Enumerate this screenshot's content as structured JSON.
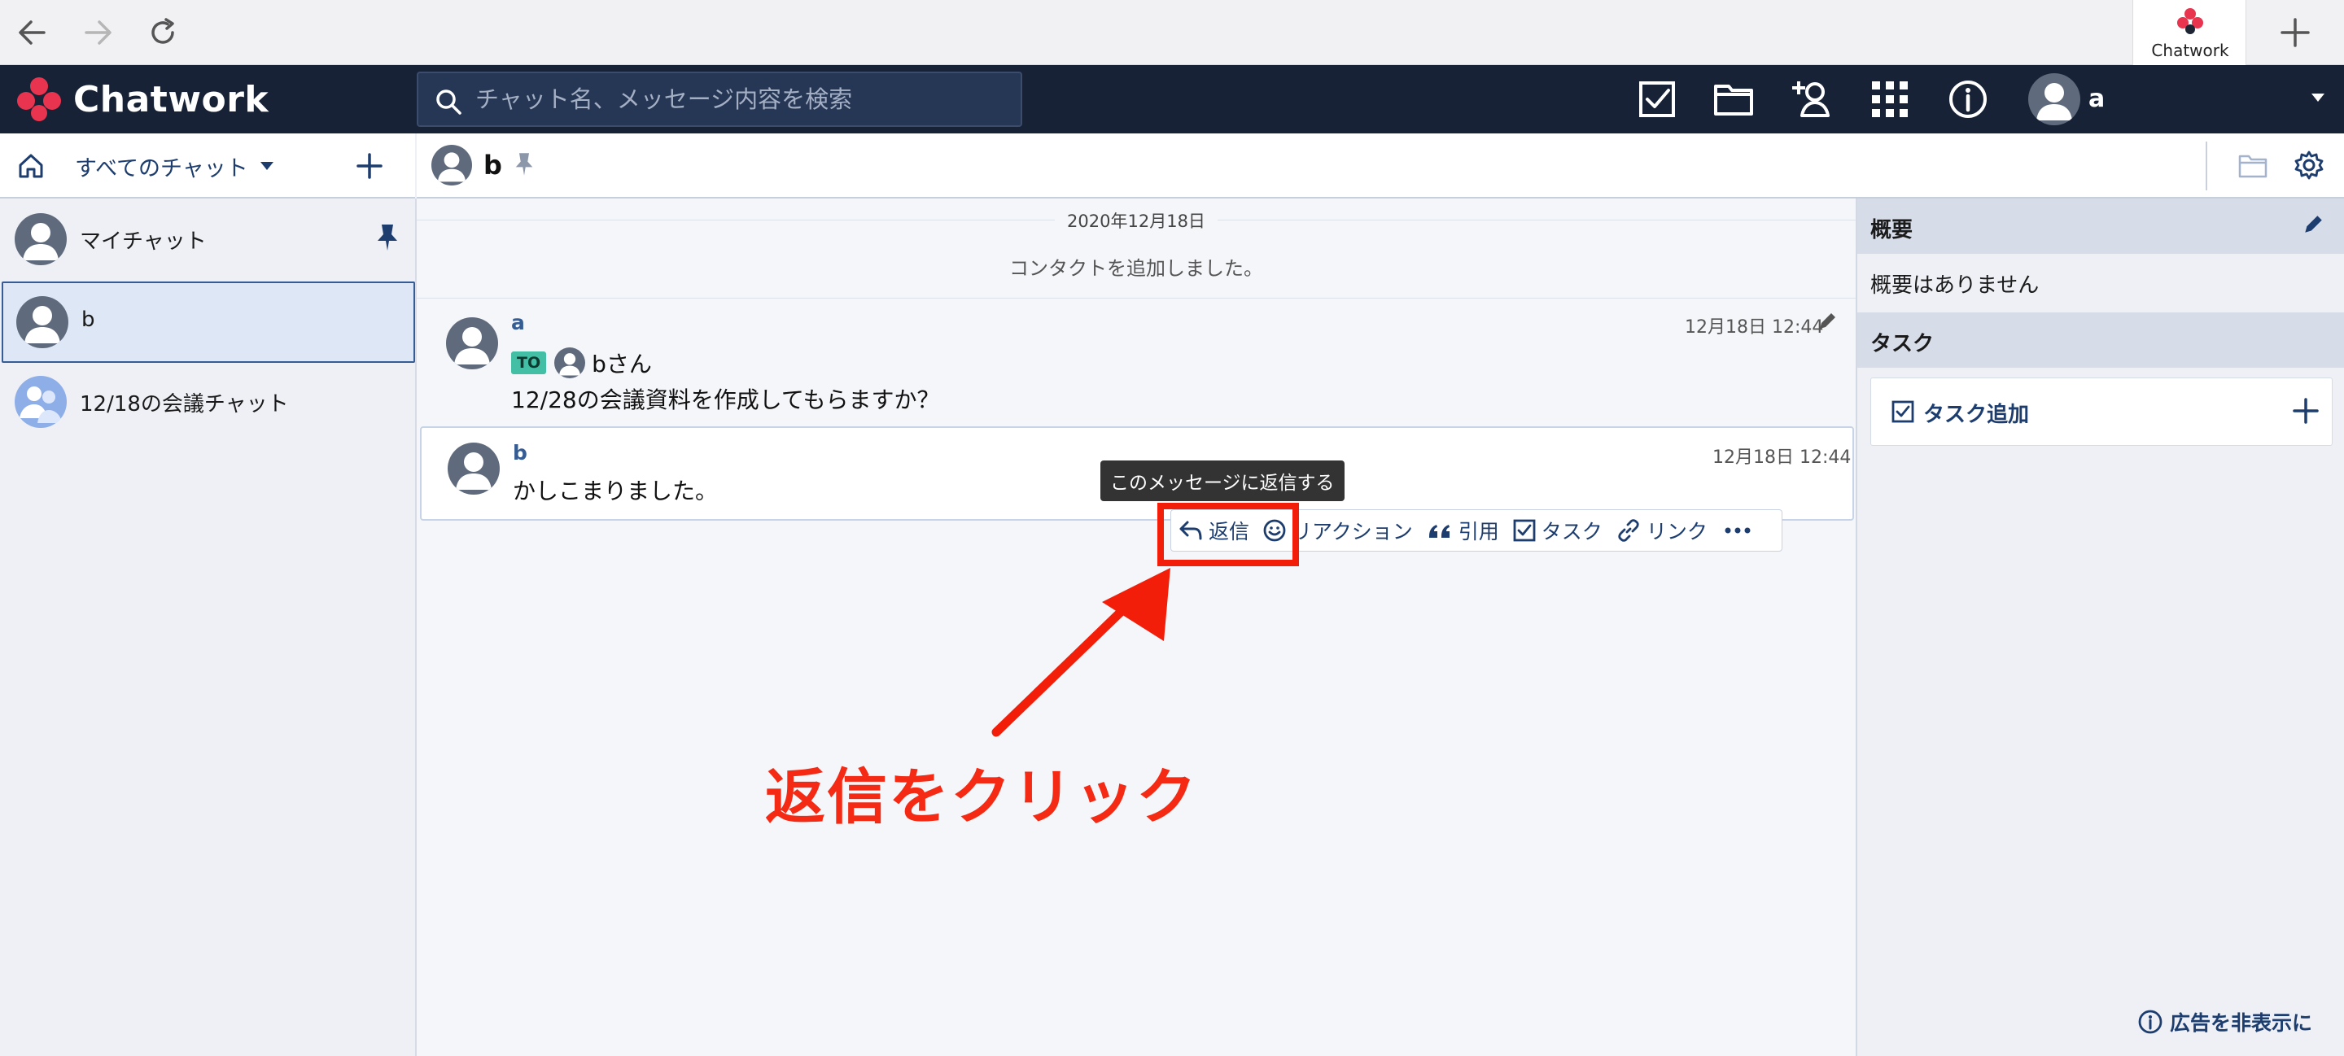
{
  "browser": {
    "tab_label": "Chatwork",
    "new_tab": "+"
  },
  "header": {
    "brand": "Chatwork",
    "search_placeholder": "チャット名、メッセージ内容を検索",
    "username": "a",
    "icons": [
      "task-icon",
      "file-icon",
      "add-contact-icon",
      "apps-icon",
      "info-icon"
    ]
  },
  "left": {
    "filter_label": "すべてのチャット",
    "chats": [
      {
        "name": "マイチャット",
        "pinned": true
      },
      {
        "name": "b",
        "selected": true
      },
      {
        "name": "12/18の会議チャット"
      }
    ]
  },
  "room": {
    "name": "b"
  },
  "timeline": {
    "date": "2020年12月18日",
    "system_message": "コンタクトを追加しました。",
    "messages": [
      {
        "sender": "a",
        "time": "12月18日 12:44",
        "to_badge": "TO",
        "to_name": "bさん",
        "text": "12/28の会議資料を作成してもらますか？"
      },
      {
        "sender": "b",
        "time": "12月18日 12:44",
        "text": "かしこまりました。"
      }
    ],
    "tooltip": "このメッセージに返信する",
    "actions": {
      "reply": "返信",
      "reaction": "リアクション",
      "quote": "引用",
      "task": "タスク",
      "link": "リンク"
    }
  },
  "annotation": {
    "text": "返信をクリック",
    "color": "#f21e0a"
  },
  "right": {
    "summary_title": "概要",
    "summary_text": "概要はありません",
    "task_title": "タスク",
    "task_add_label": "タスク追加",
    "hide_ads": "広告を非表示に"
  },
  "colors": {
    "header_bg": "#182236",
    "accent": "#1d3d6e",
    "to_badge": "#42bfa5",
    "logo": [
      "#e8344e",
      "#e8344e",
      "#e8344e",
      "#e8344e"
    ]
  }
}
